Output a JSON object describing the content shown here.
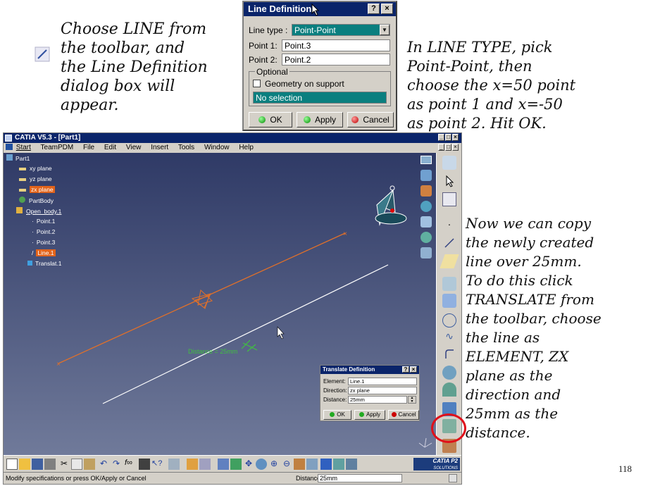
{
  "notes": {
    "top_left": "Choose LINE from\nthe toolbar, and\nthe Line Definition\ndialog box will\nappear.",
    "top_right": "In LINE TYPE, pick\nPoint-Point, then\nchoose the x=50 point\nas point 1 and x=-50\nas point 2. Hit OK.",
    "right": "Now we can copy\nthe newly created\nline over 25mm.\nTo do this click\nTRANSLATE from\nthe toolbar, choose\nthe line as\nELEMENT, ZX\nplane as the\ndirection and\n25mm as the\ndistance."
  },
  "page_number": "118",
  "line_dialog": {
    "title": "Line Definition",
    "help_btn": "?",
    "close_btn": "×",
    "line_type_label": "Line type :",
    "line_type_value": "Point-Point",
    "point1_label": "Point 1:",
    "point1_value": "Point.3",
    "point2_label": "Point 2:",
    "point2_value": "Point.2",
    "optional_label": "Optional",
    "geometry_label": "Geometry on support",
    "no_selection": "No selection",
    "ok": "OK",
    "apply": "Apply",
    "cancel": "Cancel"
  },
  "catia": {
    "title": "CATIA V5.3 - [Part1]",
    "menu": [
      "Start",
      "TeamPDM",
      "File",
      "Edit",
      "View",
      "Insert",
      "Tools",
      "Window",
      "Help"
    ],
    "window_controls": [
      "_",
      "□",
      "×"
    ],
    "tree": {
      "root": "Part1",
      "items": [
        "xy plane",
        "yz plane",
        "zx plane",
        "PartBody",
        "Open_body.1"
      ],
      "children": [
        "Point.1",
        "Point.2",
        "Point.3",
        "Line.1",
        "Translat.1"
      ]
    },
    "distance_label": "Distance = 25mm",
    "status_left": "Modify specifications or press OK/Apply or Cancel",
    "status_distance_label": "Distance",
    "status_distance_value": "25mm",
    "brand": "CATIA P2",
    "brand_sub": "SOLUTIONS"
  },
  "translate_dialog": {
    "title": "Translate Definition",
    "help_btn": "?",
    "close_btn": "×",
    "element_label": "Element:",
    "element_value": "Line.1",
    "direction_label": "Direction:",
    "direction_value": "zx plane",
    "distance_label": "Distance:",
    "distance_value": "25mm",
    "ok": "OK",
    "apply": "Apply",
    "cancel": "Cancel"
  },
  "colors": {
    "title_blue": "#0a246a",
    "highlight_orange": "#e2631a",
    "combo_teal": "#0a7f7f",
    "callout_red": "#e0101a"
  }
}
